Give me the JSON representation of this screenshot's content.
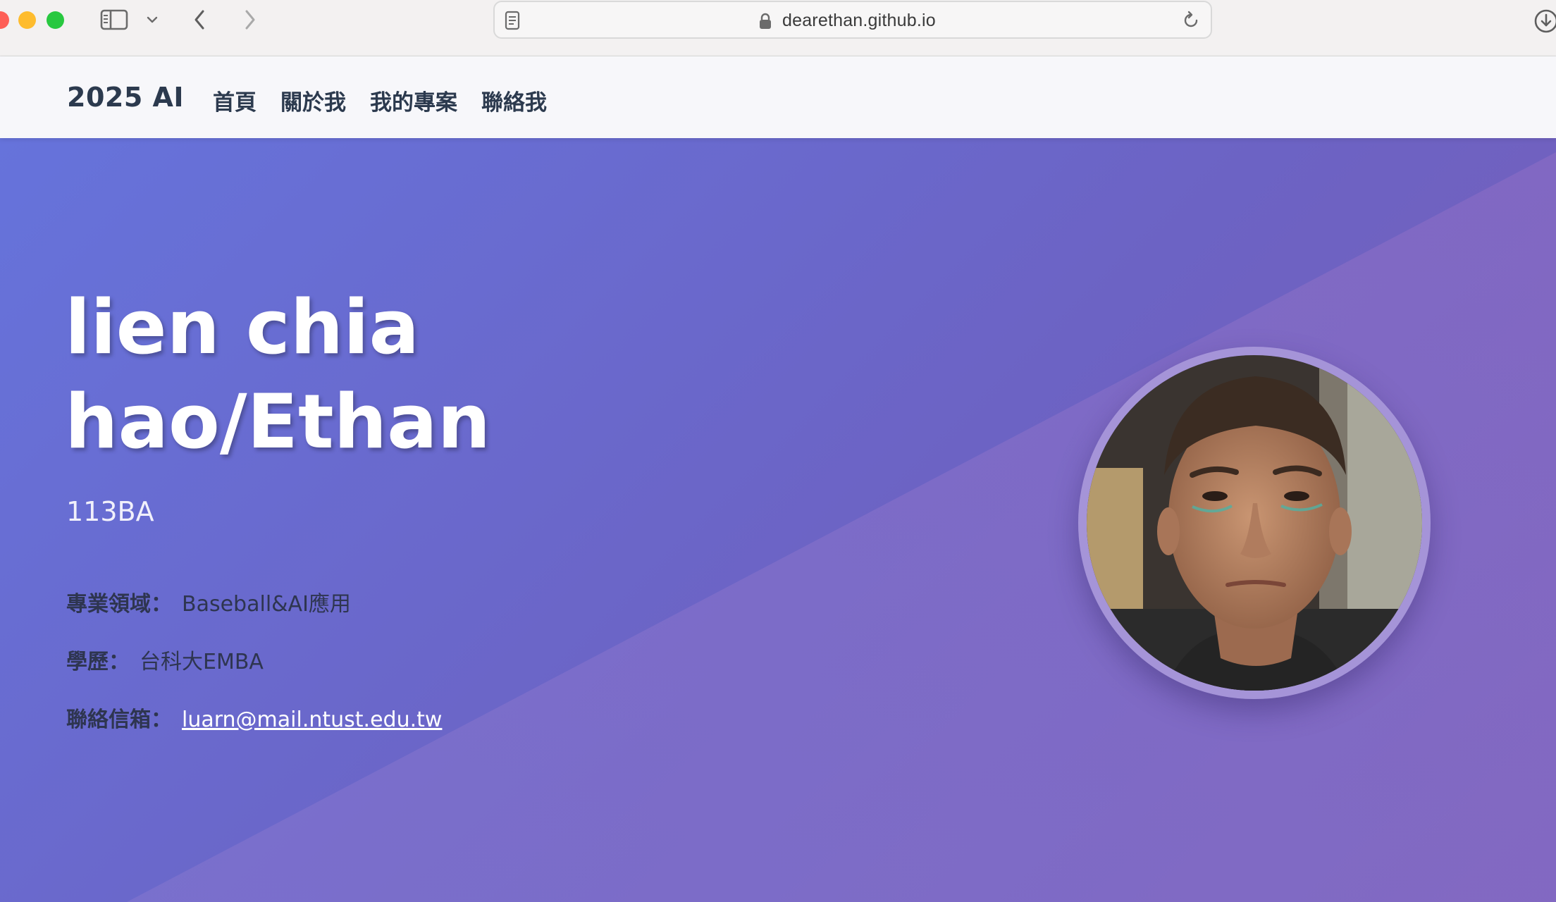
{
  "browser": {
    "url": "dearethan.github.io"
  },
  "nav": {
    "brand": "2025 AI",
    "links": [
      "首頁",
      "關於我",
      "我的專案",
      "聯絡我"
    ]
  },
  "hero": {
    "name": "lien chia hao/Ethan",
    "subtitle": "113BA",
    "specialty_label": "專業領域：",
    "specialty_value": "Baseball&AI應用",
    "education_label": "學歷：",
    "education_value": "台科大EMBA",
    "email_label": "聯絡信箱：",
    "email_value": "luarn@mail.ntust.edu.tw"
  },
  "colors": {
    "hero_gradient_start": "#6673db",
    "hero_gradient_end": "#7a5cb6",
    "nav_text": "#2c3a4e",
    "avatar_ring": "#a594d8"
  },
  "icons": {
    "sidebar": "sidebar-icon",
    "sidebar_menu": "chevron-down-icon",
    "back": "chevron-left-icon",
    "forward": "chevron-right-icon",
    "reader": "reader-icon",
    "lock": "lock-icon",
    "reload": "reload-icon",
    "download": "download-icon"
  }
}
